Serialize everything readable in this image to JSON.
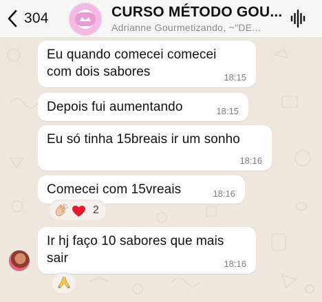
{
  "header": {
    "back_count": "304",
    "title": "CURSO MÉTODO GOU...",
    "subtitle": "Adrianne Gourmetizando, ~\"DE...",
    "avatar_icon": "group-logo"
  },
  "messages": [
    {
      "text": "Eu quando comecei comecei\ncom dois sabores",
      "time": "18:15"
    },
    {
      "text": "Depois fui aumentando",
      "time": "18:15"
    },
    {
      "text": "Eu só tinha 15breais ir um sonho",
      "time": "18:16"
    },
    {
      "text": "Comecei com 15vreais",
      "time": "18:16"
    },
    {
      "text": "Ir hj faço 10 sabores que mais\nsair",
      "time": "18:16"
    }
  ],
  "reactions": {
    "first": {
      "emojis": [
        "clapping-hands",
        "red-heart"
      ],
      "count": "2"
    },
    "second": {
      "emojis": [
        "folded-hands"
      ]
    }
  },
  "colors": {
    "chat_background": "#efe7dd",
    "bubble": "#ffffff",
    "header": "#f6f6f6",
    "timestamp": "#7e7e7e"
  }
}
